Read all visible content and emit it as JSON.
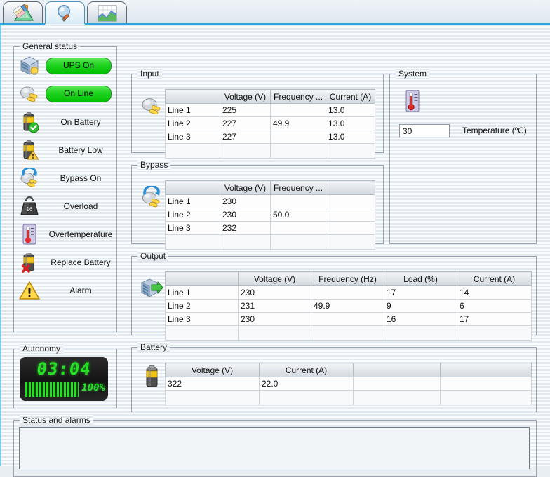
{
  "tabs": [
    {
      "id": "configuration",
      "icon": "ruler-pencil-icon",
      "label": "Configuration",
      "selected": false
    },
    {
      "id": "monitoring",
      "icon": "magnifier-icon",
      "label": "Monitoring",
      "selected": true
    },
    {
      "id": "graphs",
      "icon": "chart-icon",
      "label": "Graphs",
      "selected": false
    }
  ],
  "general_status": {
    "title": "General status",
    "items": [
      {
        "label": "UPS On",
        "icon": "server-bulb-icon",
        "style": "pill",
        "active": true
      },
      {
        "label": "On Line",
        "icon": "plug-icon",
        "style": "pill",
        "active": true
      },
      {
        "label": "On Battery",
        "icon": "battery-check-icon",
        "style": "text",
        "active": false
      },
      {
        "label": "Battery Low",
        "icon": "battery-warning-icon",
        "style": "text",
        "active": false
      },
      {
        "label": "Bypass On",
        "icon": "bypass-plug-icon",
        "style": "text",
        "active": false
      },
      {
        "label": "Overload",
        "icon": "weight-icon",
        "style": "text",
        "active": false
      },
      {
        "label": "Overtemperature",
        "icon": "thermometer-icon",
        "style": "text",
        "active": false
      },
      {
        "label": "Replace Battery",
        "icon": "battery-cross-icon",
        "style": "text",
        "active": false
      },
      {
        "label": "Alarm",
        "icon": "warning-triangle-icon",
        "style": "text",
        "active": false
      }
    ],
    "pill_color": "#21d421"
  },
  "autonomy": {
    "title": "Autonomy",
    "time": "03:04",
    "percent": "100%",
    "bar_fill": 100,
    "lcd_color": "#25e025"
  },
  "input": {
    "title": "Input",
    "icon": "plug-icon",
    "columns": [
      "",
      "Voltage (V)",
      "Frequency ...",
      "Current (A)"
    ],
    "rows": [
      [
        "Line 1",
        "225",
        "",
        "13.0"
      ],
      [
        "Line 2",
        "227",
        "49.9",
        "13.0"
      ],
      [
        "Line 3",
        "227",
        "",
        "13.0"
      ]
    ]
  },
  "bypass": {
    "title": "Bypass",
    "icon": "bypass-plug-icon",
    "columns": [
      "",
      "Voltage (V)",
      "Frequency ...",
      ""
    ],
    "rows": [
      [
        "Line 1",
        "230",
        "",
        ""
      ],
      [
        "Line 2",
        "230",
        "50.0",
        ""
      ],
      [
        "Line 3",
        "232",
        "",
        ""
      ]
    ]
  },
  "output": {
    "title": "Output",
    "icon": "output-arrow-icon",
    "columns": [
      "",
      "Voltage (V)",
      "Frequency (Hz)",
      "Load (%)",
      "Current (A)"
    ],
    "rows": [
      [
        "Line 1",
        "230",
        "",
        "17",
        "14"
      ],
      [
        "Line 2",
        "231",
        "49.9",
        "9",
        "6"
      ],
      [
        "Line 3",
        "230",
        "",
        "16",
        "17"
      ]
    ]
  },
  "battery": {
    "title": "Battery",
    "icon": "battery-icon",
    "columns": [
      "Voltage (V)",
      "Current (A)",
      "",
      ""
    ],
    "rows": [
      [
        "322",
        "22.0",
        "",
        ""
      ]
    ]
  },
  "system": {
    "title": "System",
    "icon": "thermometer-icon",
    "temperature_value": "30",
    "temperature_label": "Temperature (ºC)"
  },
  "alarms": {
    "title": "Status and alarms",
    "content": ""
  }
}
